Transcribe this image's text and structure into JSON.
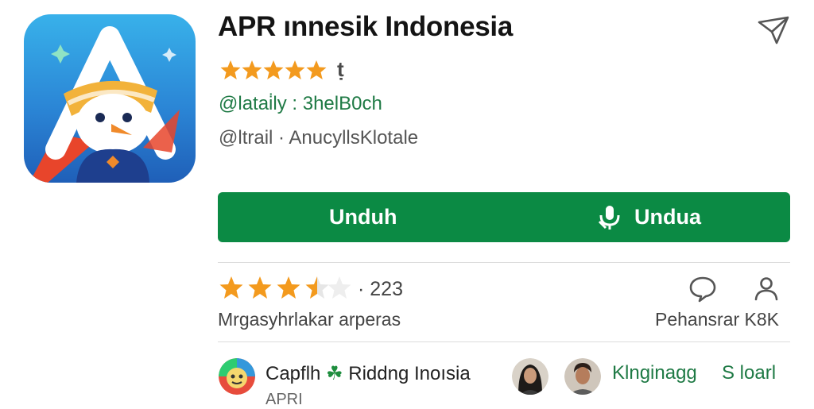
{
  "app": {
    "title": "APR ınnesik Indonesia",
    "star_glyph_after": "ṭ",
    "top_rating_stars": 5,
    "developer": "@latai̇ly : 3helB0ch",
    "meta": "@ltrail · AnucyllsKlotale"
  },
  "actions": {
    "install_left": "Unduh",
    "install_right": "Undua"
  },
  "ratings": {
    "stars": 3.5,
    "count": "· 223",
    "label": "Mrgasyhrlakar arperas",
    "right_label": "Pehansrar K8K"
  },
  "people": {
    "first_name": "Capflh",
    "first_name_suffix": "Riddng Inoısia",
    "first_sub": "APRI",
    "link_1": "Klnginagg",
    "link_2": "S loarl"
  },
  "icons": {
    "share": "share-icon",
    "chat": "chat-bubble-icon",
    "person": "person-icon",
    "mic": "microphone-icon",
    "clover": "clover-icon"
  },
  "colors": {
    "accent_green": "#0b8a44",
    "star_orange": "#f39a1e",
    "text_green": "#1f7a45"
  }
}
